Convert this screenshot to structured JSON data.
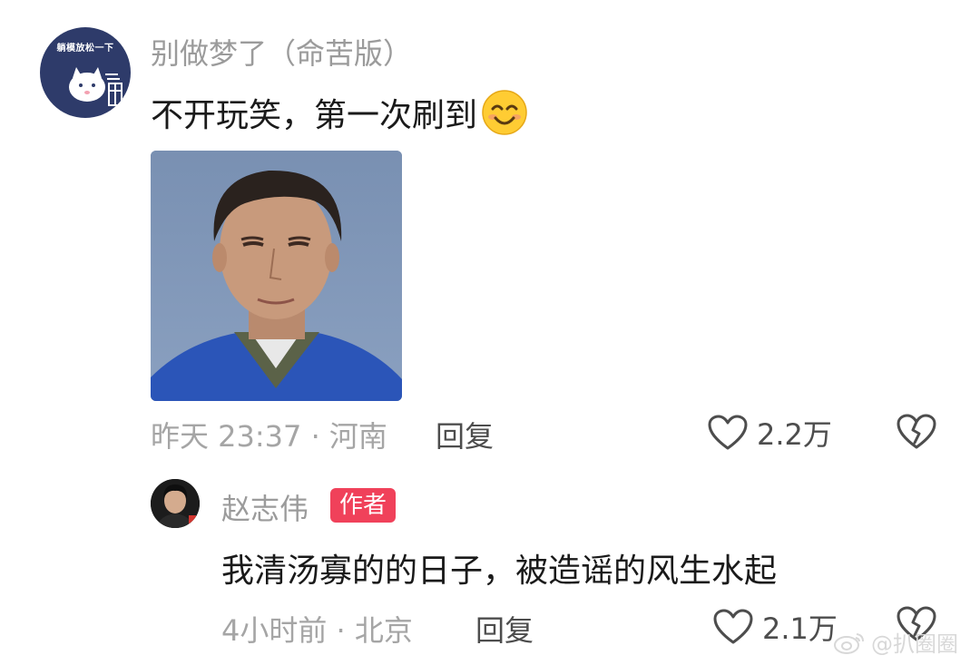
{
  "comment": {
    "avatar_text": "躺模放松一下",
    "username": "别做梦了（命苦版）",
    "text": "不开玩笑，第一次刷到",
    "emoji": "smiling-face-icon",
    "meta": "昨天 23:37 · 河南",
    "reply_label": "回复",
    "like_count": "2.2万"
  },
  "reply": {
    "username": "赵志伟",
    "badge": "作者",
    "text": "我清汤寡的的日子，被造谣的风生水起",
    "meta": "4小时前 · 北京",
    "reply_label": "回复",
    "like_count": "2.1万"
  },
  "watermark": {
    "text": "@扒圈圈"
  },
  "colors": {
    "badge": "#f0415a",
    "meta": "#a5a5a5",
    "body": "#1a1a1a",
    "avatar_bg": "#2e3b6a"
  }
}
